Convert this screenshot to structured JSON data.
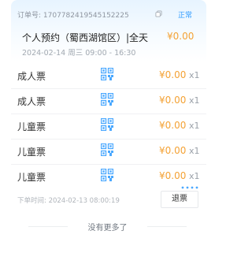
{
  "order": {
    "number_label": "订单号: ",
    "number": "1707782419545152225",
    "status": "正常",
    "title": "个人预约（蜀西湖馆区）|全天",
    "amount": "¥0.00",
    "datetime": "2024-02-14 周三 09:00 - 16:30",
    "order_time_label": "下单时间: ",
    "order_time": "2024-02-13 08:00:19",
    "refund_label": "退票"
  },
  "tickets": [
    {
      "name": "成人票",
      "price": "¥0.00",
      "qty": "x1"
    },
    {
      "name": "成人票",
      "price": "¥0.00",
      "qty": "x1"
    },
    {
      "name": "儿童票",
      "price": "¥0.00",
      "qty": "x1"
    },
    {
      "name": "儿童票",
      "price": "¥0.00",
      "qty": "x1"
    },
    {
      "name": "儿童票",
      "price": "¥0.00",
      "qty": "x1"
    }
  ],
  "footer": {
    "no_more": "没有更多了"
  },
  "colors": {
    "accent": "#2f9bff",
    "price": "#f4a235",
    "qr": "#4aa8ff"
  },
  "icons": {
    "copy": "copy-icon",
    "qr": "qrcode-icon"
  }
}
